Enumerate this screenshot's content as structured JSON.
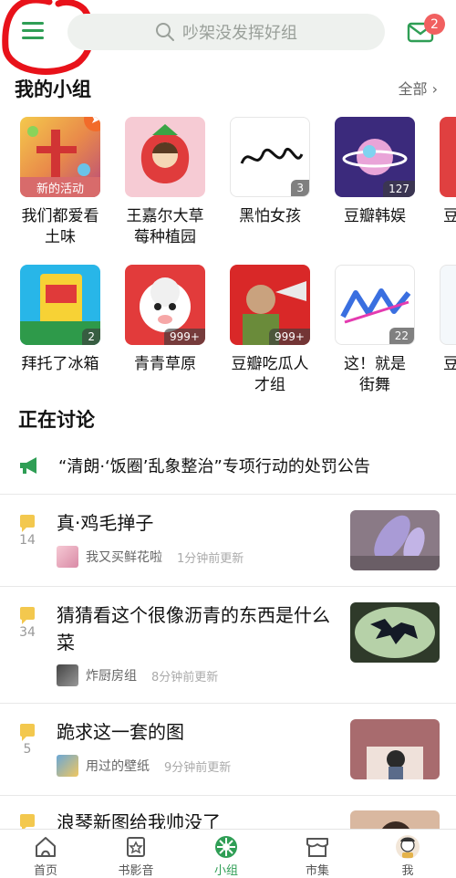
{
  "header": {
    "search_placeholder": "吵架没发挥好组",
    "mail_badge": "2"
  },
  "my_groups": {
    "title": "我的小组",
    "all_label": "全部",
    "groups": [
      {
        "name_line1": "我们都爱看",
        "name_line2": "土味",
        "event_label": "新的活动"
      },
      {
        "name_line1": "王嘉尔大草",
        "name_line2": "莓种植园"
      },
      {
        "name_line1": "黑怕女孩",
        "name_line2": "",
        "count": "3"
      },
      {
        "name_line1": "豆瓣韩娱",
        "name_line2": "",
        "count": "127"
      },
      {
        "name_line1": "豆",
        "name_line2": ""
      },
      {
        "name_line1": "拜托了冰箱",
        "name_line2": "",
        "count": "2"
      },
      {
        "name_line1": "青青草原",
        "name_line2": "",
        "count": "999+"
      },
      {
        "name_line1": "豆瓣吃瓜人",
        "name_line2": "才组",
        "count": "999+"
      },
      {
        "name_line1": "这！就是",
        "name_line2": "街舞",
        "count": "22"
      },
      {
        "name_line1": "豆",
        "name_line2": ""
      }
    ]
  },
  "discussing": {
    "title": "正在讨论",
    "announcement": "“清朗·‘饭圈’乱象整治”专项行动的处罚公告",
    "topics": [
      {
        "title": "真·鸡毛掸子",
        "count": "14",
        "group": "我又买鲜花啦",
        "time": "1分钟前更新"
      },
      {
        "title": "猜猜看这个很像沥青的东西是什么菜",
        "count": "34",
        "group": "炸厨房组",
        "time": "8分钟前更新"
      },
      {
        "title": "跪求这一套的图",
        "count": "5",
        "group": "用过的壁纸",
        "time": "9分钟前更新"
      },
      {
        "title": "浪琴新图给我帅没了",
        "count": "",
        "group": "",
        "time": ""
      }
    ]
  },
  "tabbar": [
    {
      "label": "首页",
      "icon": "home-icon"
    },
    {
      "label": "书影音",
      "icon": "media-icon"
    },
    {
      "label": "小组",
      "icon": "group-icon"
    },
    {
      "label": "市集",
      "icon": "market-icon"
    },
    {
      "label": "我",
      "icon": "profile-avatar"
    }
  ],
  "colors": {
    "accent": "#2f9e55",
    "badge": "#f16060",
    "event": "#d86b6b",
    "topic_icon": "#f3c84e"
  }
}
